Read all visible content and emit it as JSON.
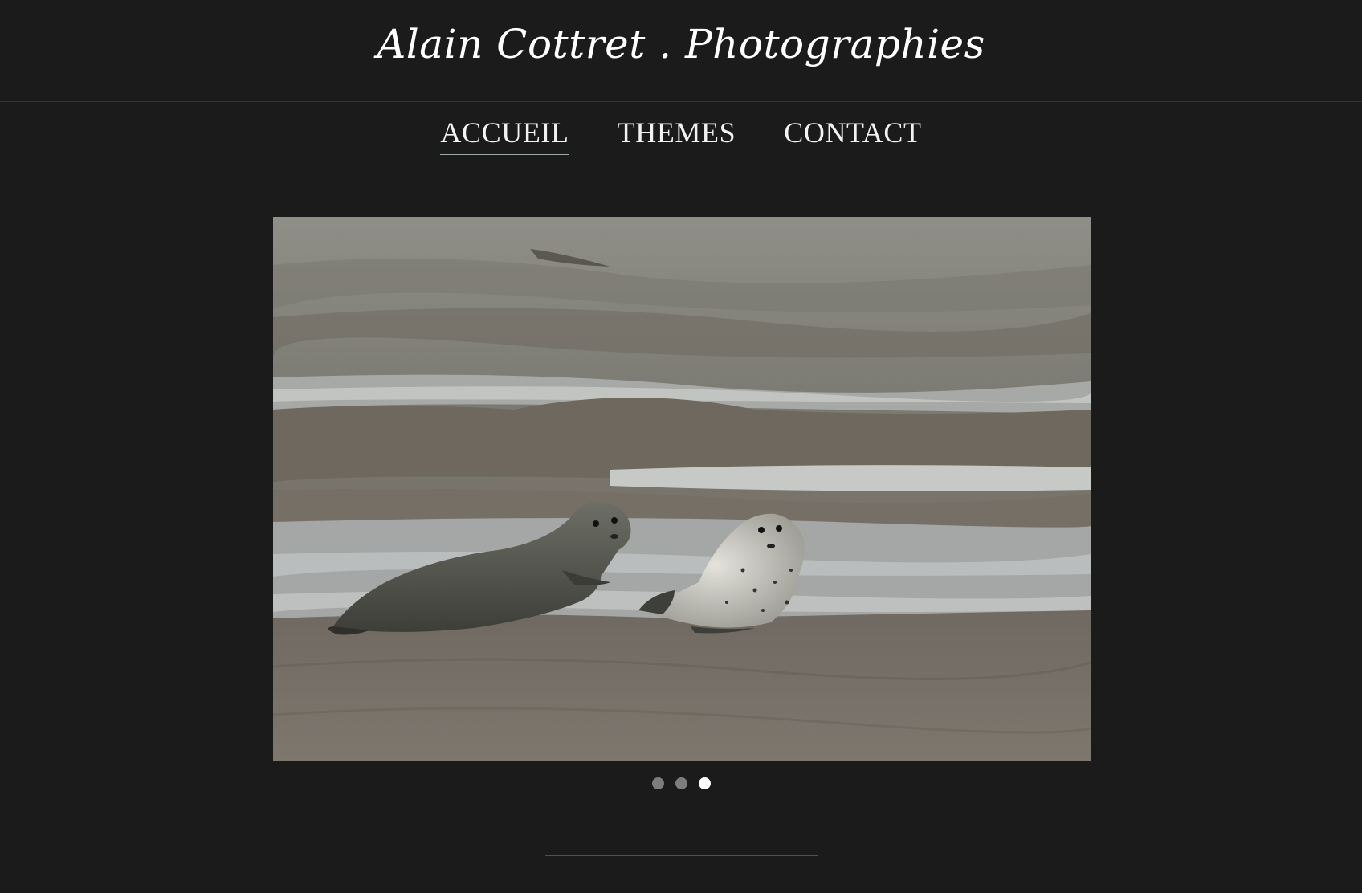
{
  "site": {
    "title": "Alain Cottret . Photographies"
  },
  "nav": {
    "items": [
      {
        "label": "ACCUEIL",
        "active": true
      },
      {
        "label": "THEMES",
        "active": false
      },
      {
        "label": "CONTACT",
        "active": false
      }
    ]
  },
  "slider": {
    "photo_alt": "Deux phoques sur un banc de sable",
    "slide_count": 3,
    "active_index": 3
  },
  "colors": {
    "background": "#1c1b1b",
    "text": "#ffffff",
    "dot_inactive": "#7d7d7d",
    "dot_active": "#ffffff"
  }
}
